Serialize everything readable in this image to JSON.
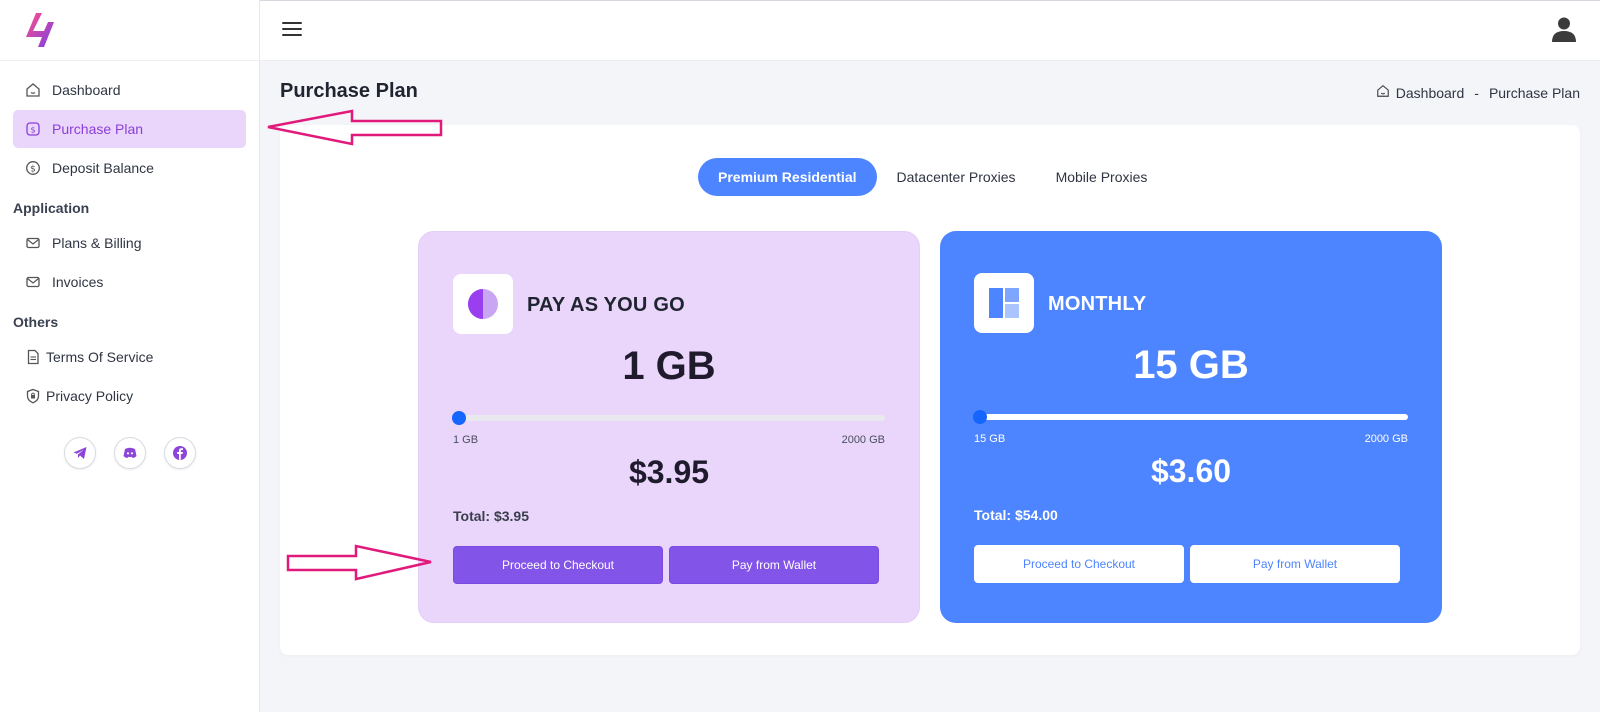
{
  "sidebar": {
    "items": [
      {
        "label": "Dashboard",
        "icon": "home-icon"
      },
      {
        "label": "Purchase Plan",
        "icon": "purchase-icon",
        "active": true
      },
      {
        "label": "Deposit Balance",
        "icon": "dollar-circle-icon"
      }
    ],
    "section_application": "Application",
    "application_items": [
      {
        "label": "Plans & Billing",
        "icon": "mail-icon"
      },
      {
        "label": "Invoices",
        "icon": "mail-icon"
      }
    ],
    "section_others": "Others",
    "others_items": [
      {
        "label": "Terms Of Service",
        "icon": "document-icon"
      },
      {
        "label": "Privacy Policy",
        "icon": "shield-icon"
      }
    ],
    "socials": [
      "telegram-icon",
      "discord-icon",
      "facebook-icon"
    ]
  },
  "page": {
    "title": "Purchase Plan",
    "breadcrumb": {
      "home": "Dashboard",
      "separator": "-",
      "current": "Purchase Plan"
    }
  },
  "tabs": [
    {
      "label": "Premium Residential",
      "active": true
    },
    {
      "label": "Datacenter Proxies"
    },
    {
      "label": "Mobile Proxies"
    }
  ],
  "plans": {
    "payg": {
      "name": "PAY AS YOU GO",
      "size": "1 GB",
      "range_min": "1 GB",
      "range_max": "2000 GB",
      "slider_value_gb": 1,
      "price": "$3.95",
      "total": "Total: $3.95",
      "checkout_label": "Proceed to Checkout",
      "wallet_label": "Pay from Wallet"
    },
    "monthly": {
      "name": "MONTHLY",
      "size": "15 GB",
      "range_min": "15 GB",
      "range_max": "2000 GB",
      "slider_value_gb": 15,
      "price": "$3.60",
      "total": "Total: $54.00",
      "checkout_label": "Proceed to Checkout",
      "wallet_label": "Pay from Wallet"
    }
  },
  "colors": {
    "accent_blue": "#4d84ff",
    "accent_purple": "#8354e8",
    "active_nav_bg": "#ead5fb",
    "annotation_arrow": "#e0197a"
  }
}
